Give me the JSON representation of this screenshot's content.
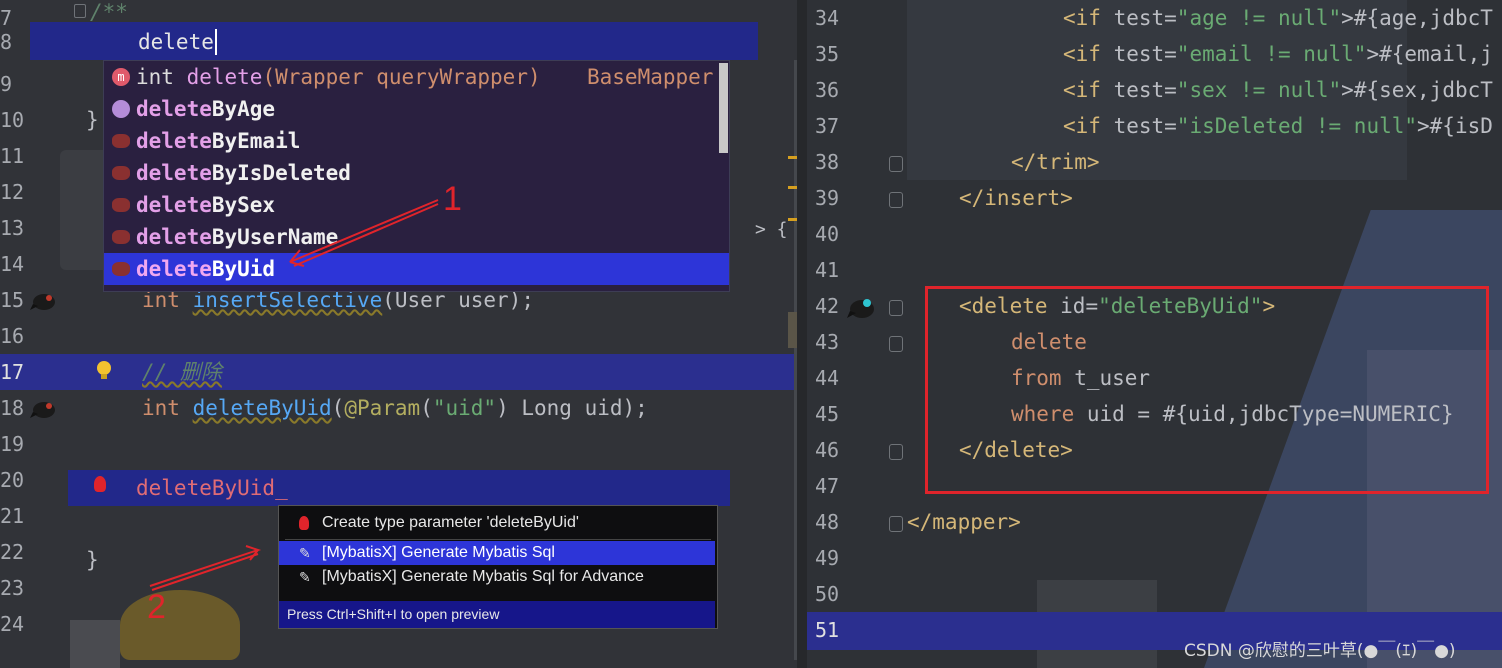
{
  "left_editor": {
    "line_numbers": [
      "7",
      "8",
      "9",
      "10",
      "11",
      "12",
      "13",
      "14",
      "15",
      "16",
      "17",
      "18",
      "19",
      "20",
      "21",
      "22",
      "23",
      "24"
    ],
    "current_line": "17",
    "line7_comment": "/**",
    "typed_text": "delete",
    "brace_close_10": "}",
    "line13_fragment": "> {",
    "line15": {
      "kw": "int",
      "name": "insertSelective",
      "rest": "(User user);"
    },
    "line17": {
      "comment": "// 删除"
    },
    "line18": {
      "kw": "int",
      "name": "deleteByUid",
      "paren": "(",
      "ann": "@Param",
      "paren2": "(",
      "str": "\"uid\"",
      "rest": ") Long uid);"
    },
    "line20_typed": "deleteByUid_",
    "line22_brace": "}"
  },
  "completion_popup": {
    "items": [
      {
        "icon": "method-m-icon",
        "type": "int",
        "name_prefix": "delete",
        "name_rest": "",
        "params": "(Wrapper queryWrapper)",
        "source": "BaseMapper"
      },
      {
        "icon": "mybatisx-icon",
        "name_prefix": "delete",
        "name_rest": "ByAge"
      },
      {
        "icon": "bird-icon",
        "name_prefix": "delete",
        "name_rest": "ByEmail"
      },
      {
        "icon": "bird-icon",
        "name_prefix": "delete",
        "name_rest": "ByIsDeleted"
      },
      {
        "icon": "bird-icon",
        "name_prefix": "delete",
        "name_rest": "BySex"
      },
      {
        "icon": "bird-icon",
        "name_prefix": "delete",
        "name_rest": "ByUserName"
      },
      {
        "icon": "bird-icon",
        "name_prefix": "delete",
        "name_rest": "ByUid"
      }
    ],
    "selected_index": 6
  },
  "intention_popup": {
    "items": [
      {
        "icon": "error-bulb-icon",
        "label": "Create type parameter 'deleteByUid'"
      },
      {
        "icon": "edit-icon",
        "label": "[MybatisX] Generate Mybatis Sql"
      },
      {
        "icon": "edit-icon",
        "label": "[MybatisX] Generate Mybatis Sql for Advance"
      }
    ],
    "selected_index": 1,
    "footer": "Press Ctrl+Shift+I to open preview"
  },
  "annotations": {
    "label1": "1",
    "label2": "2",
    "color": "#e0242b"
  },
  "right_editor": {
    "line_numbers": [
      "34",
      "35",
      "36",
      "37",
      "38",
      "39",
      "40",
      "41",
      "42",
      "43",
      "44",
      "45",
      "46",
      "47",
      "48",
      "49",
      "50",
      "51"
    ],
    "current_line": "51",
    "lines": {
      "34": {
        "tag": "<if ",
        "attr": "test=",
        "str": "\"age != null\"",
        "rest": ">#{age,jdbcT"
      },
      "35": {
        "tag": "<if ",
        "attr": "test=",
        "str": "\"email != null\"",
        "rest": ">#{email,j"
      },
      "36": {
        "tag": "<if ",
        "attr": "test=",
        "str": "\"sex != null\"",
        "rest": ">#{sex,jdbcT"
      },
      "37": {
        "tag": "<if ",
        "attr": "test=",
        "str": "\"isDeleted != null\"",
        "rest": ">#{isD"
      },
      "38": "</trim>",
      "39": "</insert>",
      "42": {
        "tag": "<delete ",
        "attr": "id=",
        "str": "\"deleteByUid\"",
        "tag2": ">"
      },
      "43": "delete",
      "44": {
        "kw": "from",
        "rest": " t_user"
      },
      "45": {
        "kw": "where",
        "rest": " uid = #{uid,jdbcType=NUMERIC}"
      },
      "46": "</delete>",
      "48": "</mapper>"
    }
  },
  "watermark": "CSDN @欣慰的三叶草(●￣(ｴ)￣●)"
}
